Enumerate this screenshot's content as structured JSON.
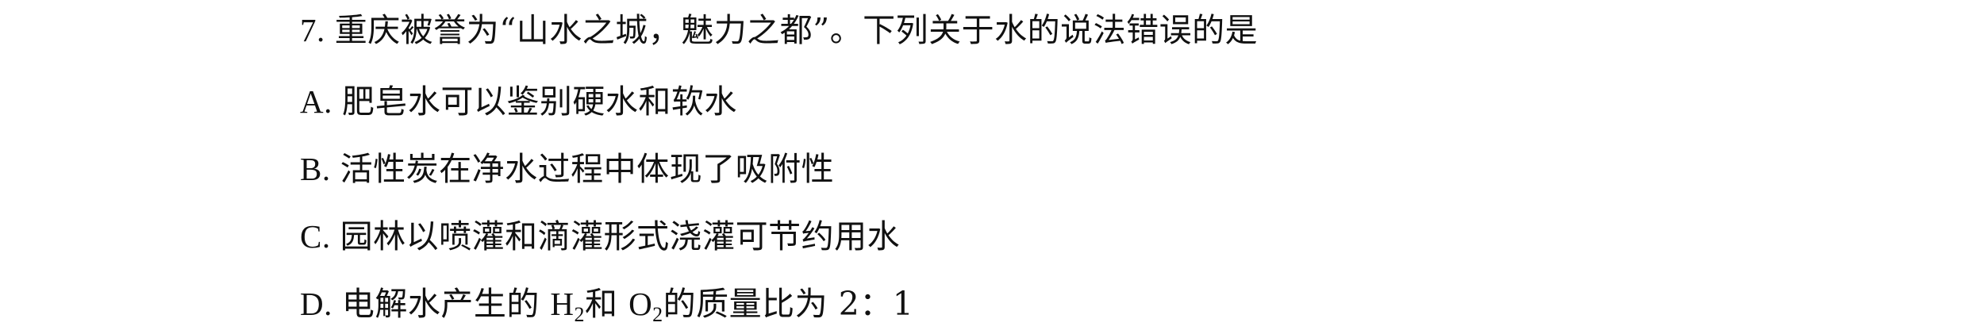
{
  "question": {
    "number": "7.",
    "stem": "重庆被誉为“山水之城，魅力之都”。下列关于水的说法错误的是"
  },
  "options": {
    "a": {
      "letter": "A.",
      "text": "肥皂水可以鉴别硬水和软水"
    },
    "b": {
      "letter": "B.",
      "text": "活性炭在净水过程中体现了吸附性"
    },
    "c": {
      "letter": "C.",
      "text": "园林以喷灌和滴灌形式浇灌可节约用水"
    },
    "d": {
      "letter": "D.",
      "text_before": "电解水产生的 ",
      "h_symbol": "H",
      "h_sub": "2",
      "text_mid": "和 ",
      "o_symbol": "O",
      "o_sub": "2",
      "text_after": "的质量比为 2：1"
    }
  }
}
